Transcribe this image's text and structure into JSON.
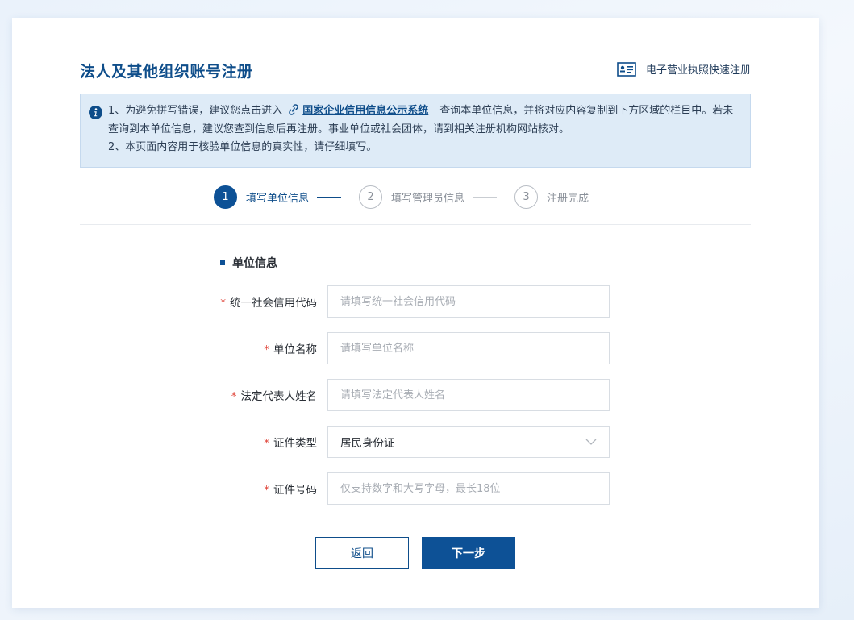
{
  "header": {
    "title": "法人及其他组织账号注册",
    "quick_register_label": "电子营业执照快速注册"
  },
  "notice": {
    "line1_before_link": "1、为避免拼写错误，建议您点击进入",
    "link_text": "国家企业信用信息公示系统",
    "line1_after_link": "查询本单位信息，并将对应内容复制到下方区域的栏目中。若未查询到本单位信息，建议您查到信息后再注册。事业单位或社会团体，请到相关注册机构网站核对。",
    "line2": "2、本页面内容用于核验单位信息的真实性，请仔细填写。"
  },
  "steps": [
    {
      "number": "1",
      "label": "填写单位信息"
    },
    {
      "number": "2",
      "label": "填写管理员信息"
    },
    {
      "number": "3",
      "label": "注册完成"
    }
  ],
  "section": {
    "title": "单位信息"
  },
  "form": {
    "required_mark": "*",
    "credit_code": {
      "label": "统一社会信用代码",
      "value": "",
      "placeholder": "请填写统一社会信用代码"
    },
    "org_name": {
      "label": "单位名称",
      "value": "",
      "placeholder": "请填写单位名称"
    },
    "legal_rep": {
      "label": "法定代表人姓名",
      "value": "",
      "placeholder": "请填写法定代表人姓名"
    },
    "id_type": {
      "label": "证件类型",
      "selected": "居民身份证"
    },
    "id_number": {
      "label": "证件号码",
      "value": "",
      "placeholder": "仅支持数字和大写字母，最长18位"
    }
  },
  "buttons": {
    "back": "返回",
    "next": "下一步"
  },
  "colors": {
    "primary": "#0d5196",
    "title": "#0e4d8a",
    "notice_bg": "#deebf7",
    "required": "#e0453a"
  }
}
